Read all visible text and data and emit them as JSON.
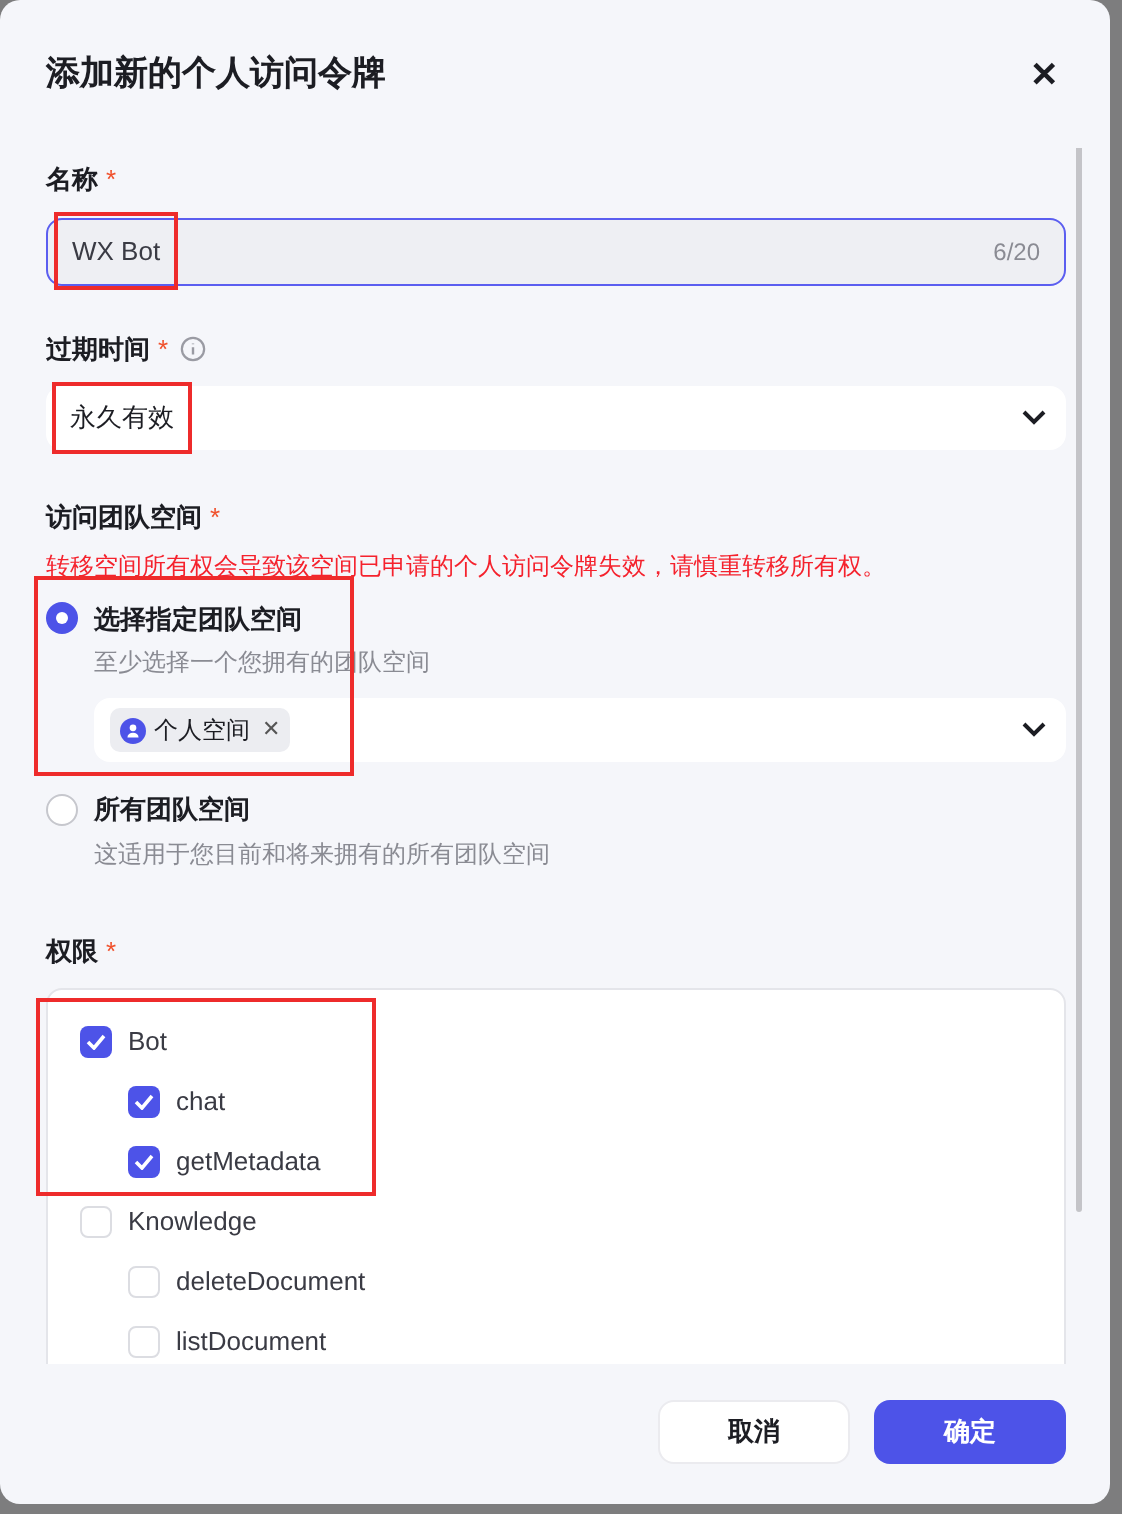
{
  "dialog": {
    "title": "添加新的个人访问令牌",
    "close": "✕"
  },
  "name_field": {
    "label": "名称",
    "required": "*",
    "value": "WX Bot",
    "counter": "6/20",
    "highlighted": true
  },
  "expiry_field": {
    "label": "过期时间",
    "required": "*",
    "value": "永久有效",
    "highlighted": true
  },
  "space_field": {
    "label": "访问团队空间",
    "required": "*",
    "warning": "转移空间所有权会导致该空间已申请的个人访问令牌失效，请慎重转移所有权。",
    "options": [
      {
        "label": "选择指定团队空间",
        "hint": "至少选择一个您拥有的团队空间",
        "selected": true,
        "highlighted": true,
        "tags": [
          {
            "label": "个人空间",
            "remove": "✕"
          }
        ]
      },
      {
        "label": "所有团队空间",
        "hint": "这适用于您目前和将来拥有的所有团队空间",
        "selected": false,
        "highlighted": false
      }
    ]
  },
  "permissions": {
    "label": "权限",
    "required": "*",
    "groups": [
      {
        "label": "Bot",
        "checked": true,
        "highlighted": true,
        "children": [
          {
            "label": "chat",
            "checked": true
          },
          {
            "label": "getMetadata",
            "checked": true
          }
        ]
      },
      {
        "label": "Knowledge",
        "checked": false,
        "highlighted": false,
        "children": [
          {
            "label": "deleteDocument",
            "checked": false
          },
          {
            "label": "listDocument",
            "checked": false
          }
        ]
      }
    ]
  },
  "buttons": [
    {
      "label": "取消",
      "kind": "secondary"
    },
    {
      "label": "确定",
      "kind": "primary"
    }
  ]
}
